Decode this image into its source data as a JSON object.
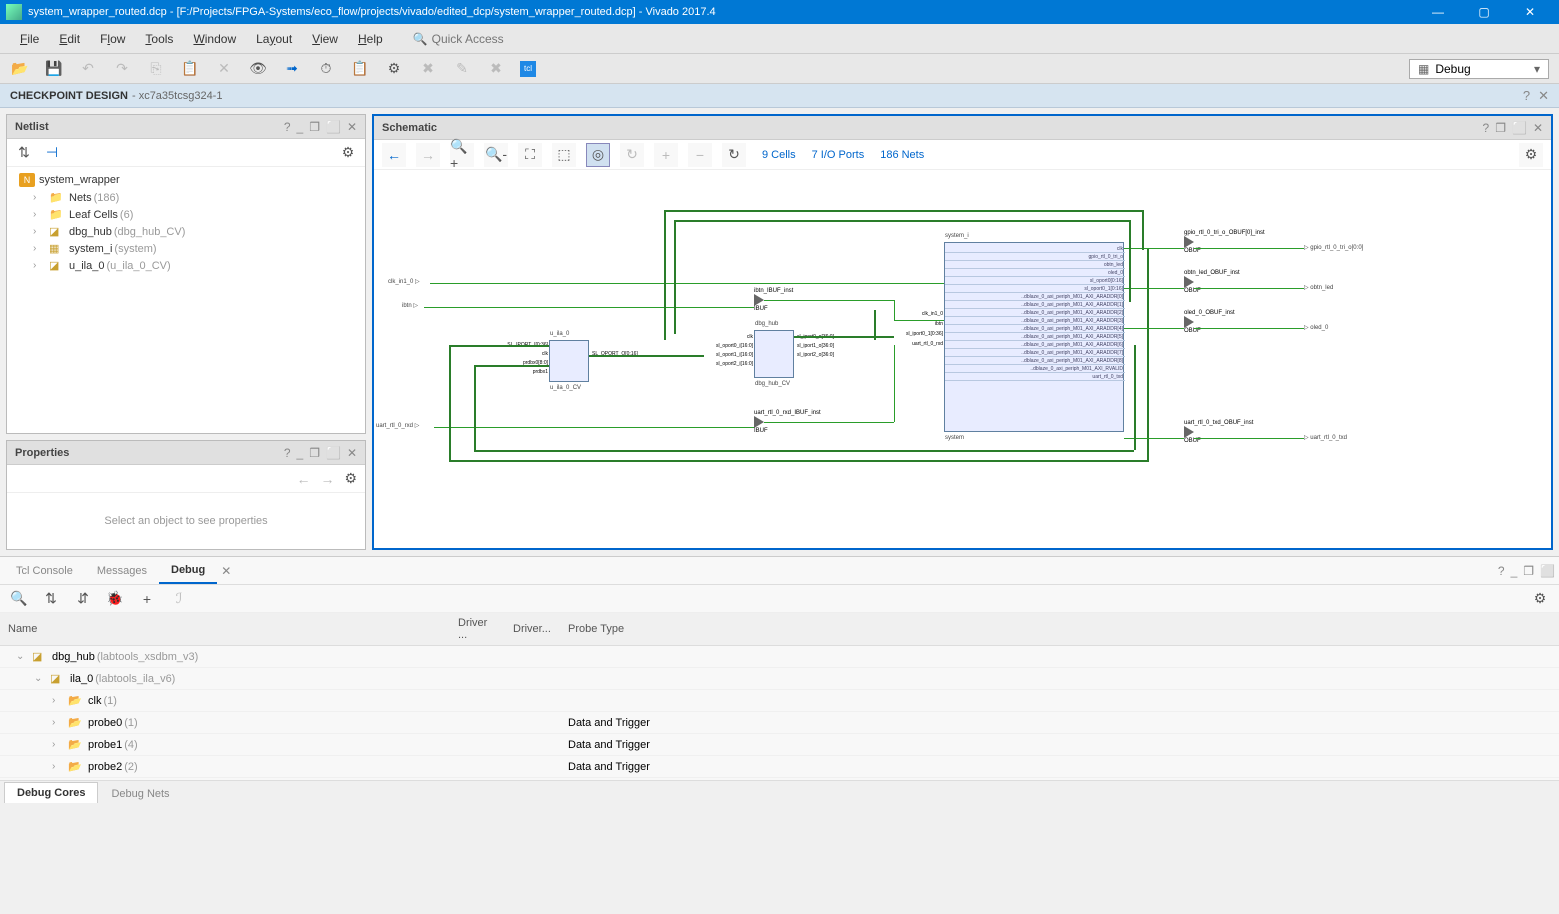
{
  "window": {
    "title": "system_wrapper_routed.dcp - [F:/Projects/FPGA-Systems/eco_flow/projects/vivado/edited_dcp/system_wrapper_routed.dcp] - Vivado 2017.4"
  },
  "menu": {
    "file": "File",
    "edit": "Edit",
    "flow": "Flow",
    "tools": "Tools",
    "window": "Window",
    "layout": "Layout",
    "view": "View",
    "help": "Help",
    "quick_access_placeholder": "Quick Access"
  },
  "mode_selector": "Debug",
  "checkpoint": {
    "label": "CHECKPOINT DESIGN",
    "device": "- xc7a35tcsg324-1"
  },
  "netlist": {
    "title": "Netlist",
    "root": "system_wrapper",
    "items": [
      {
        "label": "Nets",
        "count": "(186)"
      },
      {
        "label": "Leaf Cells",
        "count": "(6)"
      },
      {
        "label": "dbg_hub",
        "count": "(dbg_hub_CV)"
      },
      {
        "label": "system_i",
        "count": "(system)"
      },
      {
        "label": "u_ila_0",
        "count": "(u_ila_0_CV)"
      }
    ]
  },
  "properties": {
    "title": "Properties",
    "placeholder": "Select an object to see properties"
  },
  "schematic": {
    "title": "Schematic",
    "stats": {
      "cells": "9 Cells",
      "ports": "7 I/O Ports",
      "nets": "186 Nets"
    },
    "ports_left": [
      {
        "name": "clk_in1_0"
      },
      {
        "name": "ibtn"
      },
      {
        "name": "uart_rtl_0_rxd"
      }
    ],
    "ports_right": [
      {
        "name": "gpio_rtl_0_tri_o[0:0]"
      },
      {
        "name": "obtn_led"
      },
      {
        "name": "oled_0"
      },
      {
        "name": "uart_rtl_0_txd"
      }
    ],
    "blocks": {
      "u_ila": {
        "name": "u_ila_0",
        "type": "u_ila_0_CV",
        "pins_l": [
          "SL_IPORT_I[0:36]",
          "clk",
          "prdbx0[8:0]",
          "prdbx1"
        ],
        "pins_r": [
          "SL_OPORT_O[0:16]"
        ]
      },
      "ibuf1": {
        "name": "ibtn_IBUF_inst",
        "type": "IBUF"
      },
      "ibuf2": {
        "name": "uart_rtl_0_rxd_IBUF_inst",
        "type": "IBUF"
      },
      "dbg_hub": {
        "name": "dbg_hub",
        "type": "dbg_hub_CV",
        "pins_l": [
          "clk",
          "sl_oport0_i[16:0]",
          "sl_oport1_i[16:0]",
          "sl_oport2_i[16:0]"
        ],
        "pins_r": [
          "sl_iport0_o[36:0]",
          "sl_iport1_o[36:0]",
          "sl_iport2_o[36:0]"
        ]
      },
      "system": {
        "name": "system_i",
        "type": "system",
        "pins_l": [
          "clk_in1_0",
          "ibtn",
          "sl_iport0_1[0:36]",
          "uart_rtl_0_rxd"
        ],
        "pins_r": [
          "clk",
          "gpio_rtl_0_tri_o",
          "obtn_led",
          "oled_0",
          "sl_oport0[0:16]",
          "sl_oport0_1[0:16]",
          "..dblaze_0_axi_periph_M01_AXI_ARADDR[0]",
          "..dblaze_0_axi_periph_M01_AXI_ARADDR[1]",
          "..dblaze_0_axi_periph_M01_AXI_ARADDR[2]",
          "..dblaze_0_axi_periph_M01_AXI_ARADDR[3]",
          "..dblaze_0_axi_periph_M01_AXI_ARADDR[4]",
          "..dblaze_0_axi_periph_M01_AXI_ARADDR[5]",
          "..dblaze_0_axi_periph_M01_AXI_ARADDR[6]",
          "..dblaze_0_axi_periph_M01_AXI_ARADDR[7]",
          "..dblaze_0_axi_periph_M01_AXI_ARADDR[8]",
          "..dblaze_0_axi_periph_M01_AXI_RVALID",
          "uart_rtl_0_txd"
        ]
      },
      "obuf1": {
        "name": "gpio_rtl_0_tri_o_OBUF[0]_inst",
        "type": "OBUF"
      },
      "obuf2": {
        "name": "obtn_led_OBUF_inst",
        "type": "OBUF"
      },
      "obuf3": {
        "name": "oled_0_OBUF_inst",
        "type": "OBUF"
      },
      "obuf4": {
        "name": "uart_rtl_0_txd_OBUF_inst",
        "type": "OBUF"
      }
    }
  },
  "bottom": {
    "tabs": [
      {
        "label": "Tcl Console",
        "active": false
      },
      {
        "label": "Messages",
        "active": false
      },
      {
        "label": "Debug",
        "active": true
      }
    ],
    "columns": [
      "Name",
      "Driver ...",
      "Driver...",
      "Probe Type"
    ],
    "rows": [
      {
        "indent": 0,
        "expander": "⌄",
        "icon": "core",
        "name": "dbg_hub",
        "sub": "(labtools_xsdbm_v3)",
        "probe": ""
      },
      {
        "indent": 1,
        "expander": "⌄",
        "icon": "core",
        "name": "ila_0",
        "sub": "(labtools_ila_v6)",
        "probe": ""
      },
      {
        "indent": 2,
        "expander": "›",
        "icon": "folder",
        "name": "clk",
        "sub": "(1)",
        "probe": ""
      },
      {
        "indent": 2,
        "expander": "›",
        "icon": "folder",
        "name": "probe0",
        "sub": "(1)",
        "probe": "Data and Trigger"
      },
      {
        "indent": 2,
        "expander": "›",
        "icon": "folder",
        "name": "probe1",
        "sub": "(4)",
        "probe": "Data and Trigger"
      },
      {
        "indent": 2,
        "expander": "›",
        "icon": "folder",
        "name": "probe2",
        "sub": "(2)",
        "probe": "Data and Trigger"
      }
    ],
    "sub_tabs": [
      {
        "label": "Debug Cores",
        "active": true
      },
      {
        "label": "Debug Nets",
        "active": false
      }
    ]
  }
}
